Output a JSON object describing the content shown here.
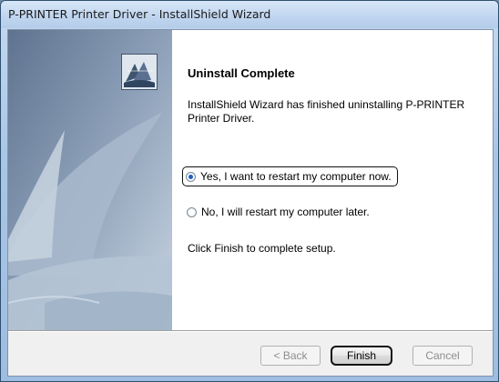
{
  "window": {
    "title": "P-PRINTER Printer Driver - InstallShield Wizard"
  },
  "content": {
    "headline": "Uninstall Complete",
    "body": "InstallShield Wizard has finished uninstalling P-PRINTER Printer Driver.",
    "options": [
      {
        "label": "Yes, I want to restart my computer now.",
        "selected": true
      },
      {
        "label": "No, I will restart my computer later.",
        "selected": false
      }
    ],
    "instruction": "Click Finish to complete setup."
  },
  "buttons": {
    "back": "< Back",
    "finish": "Finish",
    "cancel": "Cancel"
  },
  "colors": {
    "radio_selected": "#1f5fbf",
    "titlebar": "#bfd5ef"
  },
  "icons": {
    "logo": "installshield-logo-icon"
  }
}
